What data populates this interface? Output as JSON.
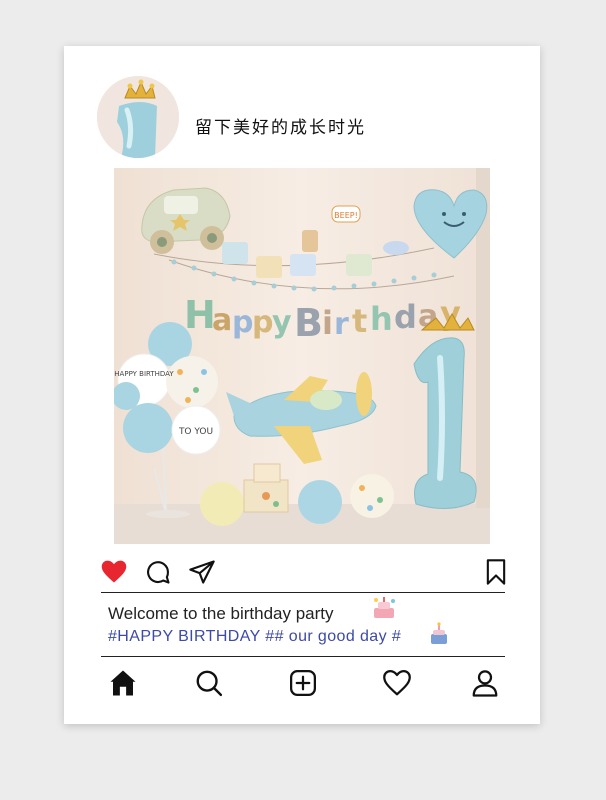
{
  "post": {
    "username": "留下美好的成长时光",
    "caption_line1": "Welcome to the birthday party",
    "hashtag1": "#HAPPY BIRTHDAY",
    "hashtag2": "##",
    "hashtag3": "our good day",
    "hashtag4": "#"
  },
  "photo": {
    "banner_letters": [
      "H",
      "a",
      "p",
      "p",
      "y",
      "B",
      "i",
      "r",
      "t",
      "h",
      "d",
      "a",
      "y"
    ],
    "banner_colors": [
      "#8fc0a8",
      "#c9a56a",
      "#9ab6d8",
      "#d7b87c",
      "#93c5b0",
      "#9aa3ad",
      "#c2a58a",
      "#9ab6d8",
      "#d7b87c",
      "#93c5b0",
      "#9aa3ad",
      "#c2a58a",
      "#d9b36a"
    ],
    "balloon_text_1": "HAPPY BIRTHDAY",
    "balloon_text_2": "TO YOU",
    "number_balloon": "1",
    "speech_bubble": "BEEP!"
  },
  "colors": {
    "heart": "#e8262f",
    "hashtag": "#3d4aa6",
    "balloon_blue": "#a8d3e0",
    "balloon_yellow": "#f5eab0"
  },
  "icons": {
    "actions": [
      "heart-filled-icon",
      "comment-icon",
      "share-icon",
      "bookmark-icon"
    ],
    "nav": [
      "home-icon",
      "search-icon",
      "add-post-icon",
      "heart-icon",
      "profile-icon"
    ]
  }
}
